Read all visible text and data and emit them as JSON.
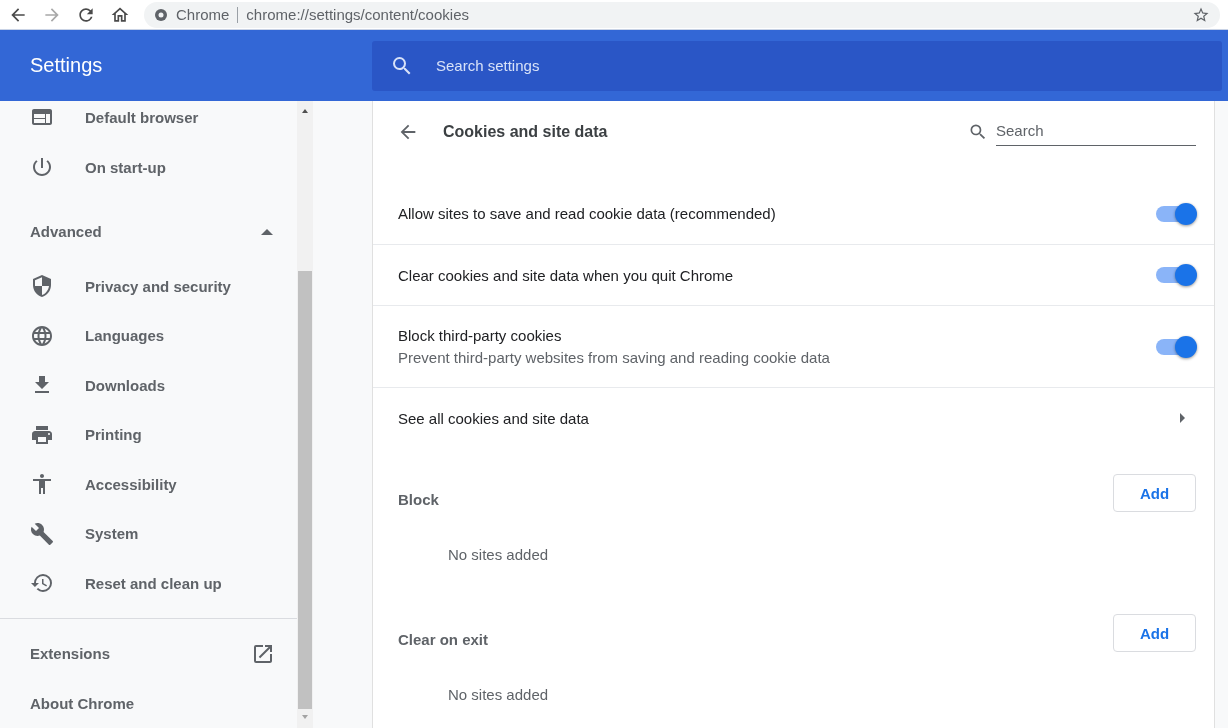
{
  "browser": {
    "nav_buttons": [
      {
        "disabled": false
      },
      {
        "disabled": true
      },
      {
        "disabled": false
      },
      {
        "disabled": false
      }
    ],
    "site_label": "Chrome",
    "url": "chrome://settings/content/cookies"
  },
  "header": {
    "title": "Settings",
    "search_placeholder": "Search settings"
  },
  "sidebar": {
    "top_items": [
      {
        "label": "Default browser"
      },
      {
        "label": "On start-up"
      }
    ],
    "advanced": {
      "label": "Advanced",
      "expanded": true
    },
    "advanced_items": [
      {
        "label": "Privacy and security"
      },
      {
        "label": "Languages"
      },
      {
        "label": "Downloads"
      },
      {
        "label": "Printing"
      },
      {
        "label": "Accessibility"
      },
      {
        "label": "System"
      },
      {
        "label": "Reset and clean up"
      }
    ],
    "bottom_items": [
      {
        "label": "Extensions",
        "external": true
      },
      {
        "label": "About Chrome",
        "external": false
      }
    ]
  },
  "page": {
    "title": "Cookies and site data",
    "search_placeholder": "Search",
    "rows": [
      {
        "kind": "toggle",
        "label": "Allow sites to save and read cookie data (recommended)",
        "on": true
      },
      {
        "kind": "toggle",
        "label": "Clear cookies and site data when you quit Chrome",
        "on": true
      },
      {
        "kind": "toggle",
        "label": "Block third-party cookies",
        "sublabel": "Prevent third-party websites from saving and reading cookie data",
        "on": true
      },
      {
        "kind": "link",
        "label": "See all cookies and site data"
      }
    ],
    "sections": [
      {
        "title": "Block",
        "button": "Add",
        "empty": "No sites added"
      },
      {
        "title": "Clear on exit",
        "button": "Add",
        "empty": "No sites added"
      }
    ]
  }
}
